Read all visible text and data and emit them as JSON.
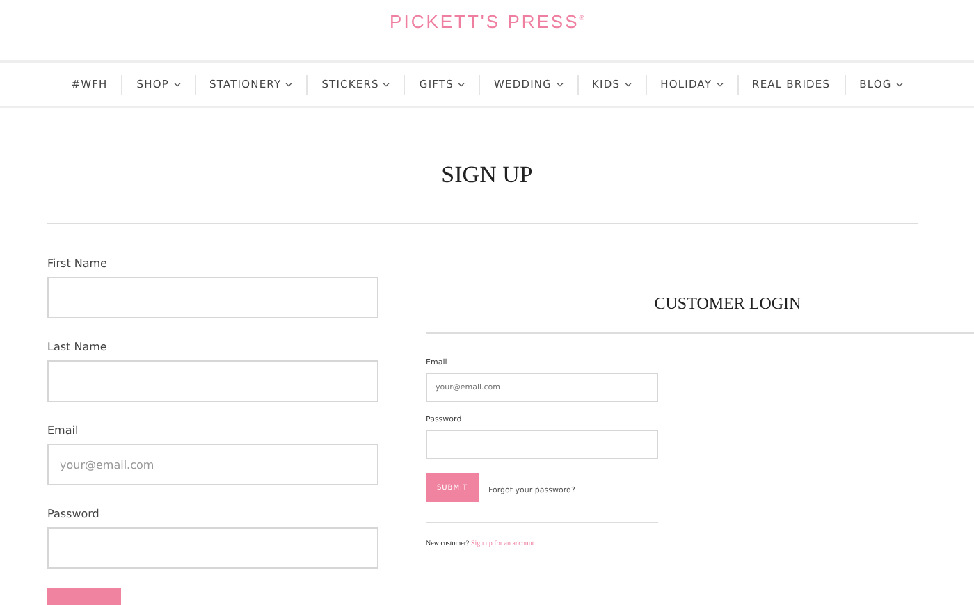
{
  "brand": {
    "logo": "PICKETT'S PRESS",
    "mark": "®"
  },
  "nav": [
    {
      "label": "#WFH",
      "dropdown": false
    },
    {
      "label": "SHOP",
      "dropdown": true
    },
    {
      "label": "STATIONERY",
      "dropdown": true
    },
    {
      "label": "STICKERS",
      "dropdown": true
    },
    {
      "label": "GIFTS",
      "dropdown": true
    },
    {
      "label": "WEDDING",
      "dropdown": true
    },
    {
      "label": "KIDS",
      "dropdown": true
    },
    {
      "label": "HOLIDAY",
      "dropdown": true
    },
    {
      "label": "REAL BRIDES",
      "dropdown": false
    },
    {
      "label": "BLOG",
      "dropdown": true
    }
  ],
  "signup": {
    "title": "SIGN UP",
    "fields": [
      {
        "label": "First Name"
      },
      {
        "label": "Last Name"
      },
      {
        "label": "Email",
        "placeholder": "your@email.com"
      },
      {
        "label": "Password"
      }
    ]
  },
  "login": {
    "title": "CUSTOMER LOGIN",
    "fields": [
      {
        "label": "Email",
        "placeholder": "your@email.com"
      },
      {
        "label": "Password"
      }
    ],
    "submit": "SUBMIT",
    "forgot": "Forgot your password?",
    "new_customer": "New customer?",
    "signup_link": "Sign up for an account"
  }
}
